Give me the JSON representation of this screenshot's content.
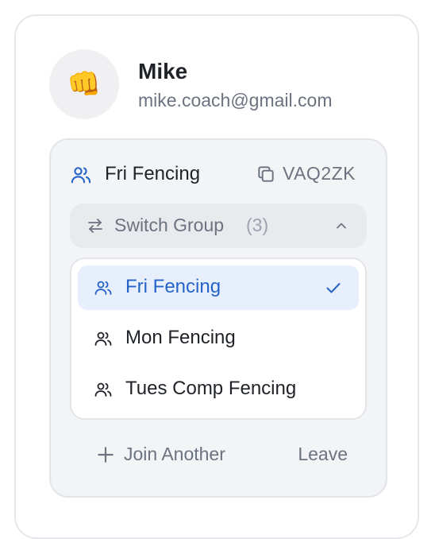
{
  "user": {
    "avatar_emoji": "👊",
    "name": "Mike",
    "email": "mike.coach@gmail.com"
  },
  "current_group": {
    "name": "Fri Fencing",
    "code": "VAQ2ZK",
    "icon": "users-icon"
  },
  "switch_group": {
    "label": "Switch Group",
    "count": "(3)",
    "expanded": true
  },
  "groups": [
    {
      "name": "Fri Fencing",
      "selected": true
    },
    {
      "name": "Mon Fencing",
      "selected": false
    },
    {
      "name": "Tues Comp Fencing",
      "selected": false
    }
  ],
  "actions": {
    "join_label": "Join Another",
    "leave_label": "Leave"
  },
  "colors": {
    "accent": "#2563c9",
    "muted_text": "#6b7280",
    "selected_bg": "#e8effc"
  }
}
